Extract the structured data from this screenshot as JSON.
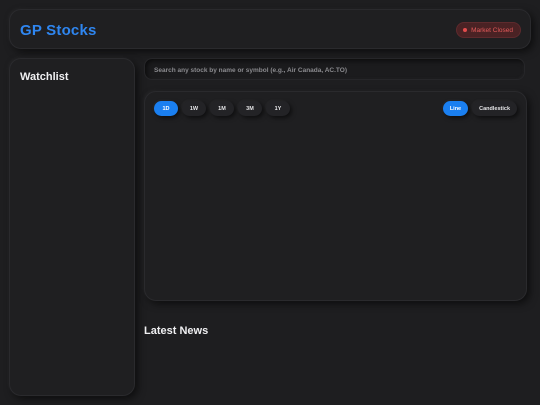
{
  "app": {
    "title": "GP Stocks"
  },
  "status": {
    "label": "Market Closed",
    "color": "#e35a5a"
  },
  "watchlist": {
    "title": "Watchlist"
  },
  "search": {
    "placeholder": "Search any stock by name or symbol (e.g., Air Canada, AC.TO)",
    "value": ""
  },
  "chart": {
    "ranges": [
      "1D",
      "1W",
      "1M",
      "3M",
      "1Y"
    ],
    "active_range": "1D",
    "types": [
      "Line",
      "Candlestick"
    ],
    "active_type": "Line"
  },
  "news": {
    "title": "Latest News"
  },
  "colors": {
    "accent": "#1a7ff0",
    "background": "#1e1e20"
  }
}
